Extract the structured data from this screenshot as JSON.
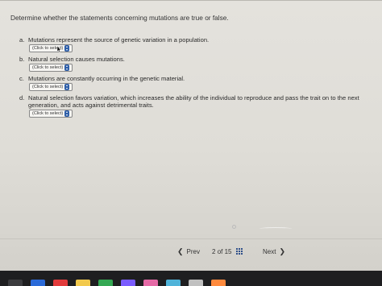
{
  "prompt": "Determine whether the statements concerning mutations are true or false.",
  "questions": [
    {
      "letter": "a.",
      "text": "Mutations represent the source of genetic variation in a population.",
      "continuation": "",
      "select_value": "(Click to select)"
    },
    {
      "letter": "b.",
      "text": "Natural selection causes mutations.",
      "continuation": "",
      "select_value": "(Click to select)"
    },
    {
      "letter": "c.",
      "text": "Mutations are constantly occurring in the genetic material.",
      "continuation": "",
      "select_value": "(Click to select)"
    },
    {
      "letter": "d.",
      "text": "Natural selection favors variation, which increases the ability of the individual to reproduce and pass the trait on to the next",
      "continuation": "generation, and acts against detrimental traits.",
      "select_value": "(Click to select)"
    }
  ],
  "nav": {
    "prev_label": "Prev",
    "current_page": "2",
    "of_label": "of",
    "total_pages": "15",
    "next_label": "Next"
  },
  "icons": {
    "prev": "chevron-left-icon",
    "next": "chevron-right-icon",
    "question_map": "grid-icon",
    "select": "select-arrows-icon"
  },
  "colors": {
    "accent": "#2f5fa8",
    "background": "#e4e2dd"
  },
  "dock_colors": [
    "#3b3b3e",
    "#2b6ad8",
    "#e23b3b",
    "#f2c94c",
    "#34a853",
    "#7a5cff",
    "#e56aa6",
    "#4fb3d9",
    "#c0c0c0",
    "#ff8a3d"
  ]
}
